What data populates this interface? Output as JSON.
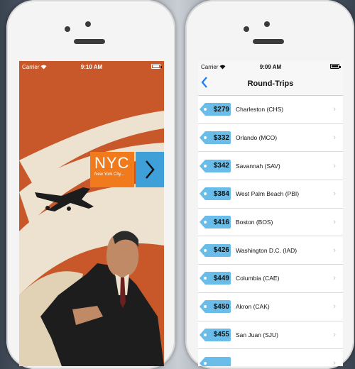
{
  "left_screen": {
    "status": {
      "carrier": "Carrier",
      "time": "9:10 AM"
    },
    "tile": {
      "title": "NYC",
      "subtitle": "New York City..."
    },
    "arrow_glyph": "›"
  },
  "right_screen": {
    "status": {
      "carrier": "Carrier",
      "time": "9:09 AM"
    },
    "nav": {
      "back_glyph": "‹",
      "title": "Round-Trips"
    },
    "flights": [
      {
        "price": "$279",
        "destination": "Charleston (CHS)"
      },
      {
        "price": "$332",
        "destination": "Orlando (MCO)"
      },
      {
        "price": "$342",
        "destination": "Savannah (SAV)"
      },
      {
        "price": "$384",
        "destination": "West Palm Beach (PBI)"
      },
      {
        "price": "$416",
        "destination": "Boston (BOS)"
      },
      {
        "price": "$426",
        "destination": "Washington D.C. (IAD)"
      },
      {
        "price": "$449",
        "destination": "Columbia (CAE)"
      },
      {
        "price": "$450",
        "destination": "Akron (CAK)"
      },
      {
        "price": "$455",
        "destination": "San Juan (SJU)"
      },
      {
        "price": "",
        "destination": ""
      }
    ]
  },
  "colors": {
    "poster_orange": "#c8582a",
    "poster_cream": "#ece2cf",
    "tile_orange": "#f07a1c",
    "tile_blue": "#3e9fd9",
    "price_tag_blue": "#69bde8",
    "ios_blue": "#1a7df7"
  },
  "icons": {
    "wifi": "wifi-icon",
    "battery": "battery-icon",
    "chevron": "chevron-right-icon",
    "back": "back-chevron-icon"
  }
}
